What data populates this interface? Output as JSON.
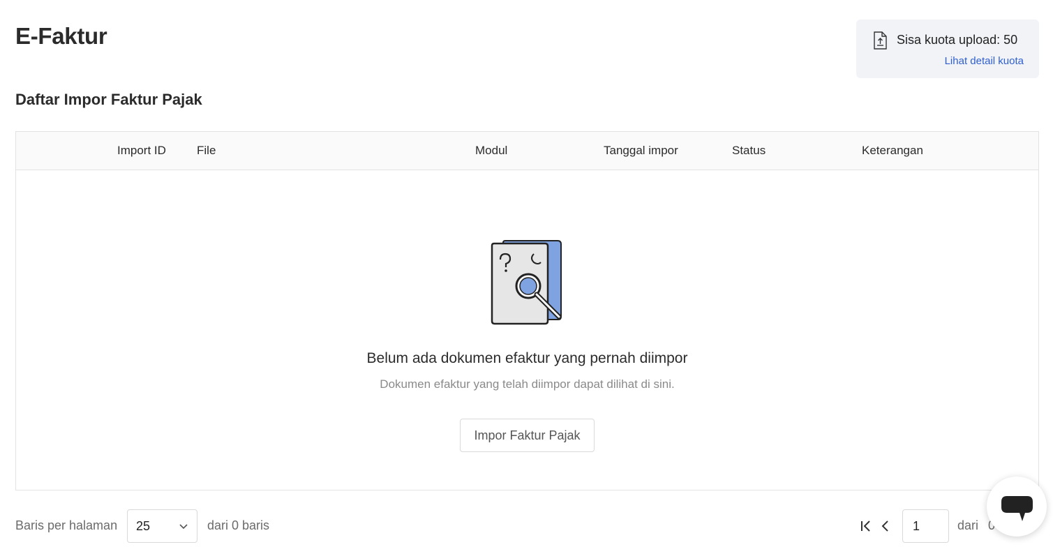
{
  "header": {
    "title": "E-Faktur"
  },
  "quota": {
    "icon": "upload-file-icon",
    "label": "Sisa kuota upload: 50",
    "link": "Lihat detail kuota"
  },
  "section": {
    "title": "Daftar Impor Faktur Pajak"
  },
  "table": {
    "columns": [
      "Import ID",
      "File",
      "Modul",
      "Tanggal impor",
      "Status",
      "Keterangan"
    ]
  },
  "empty_state": {
    "icon": "document-search-illustration",
    "title": "Belum ada dokumen efaktur yang pernah diimpor",
    "subtitle": "Dokumen efaktur yang telah diimpor dapat dilihat di sini.",
    "button": "Impor Faktur Pajak"
  },
  "pagination": {
    "rows_per_page_label": "Baris per halaman",
    "rows_per_page_value": "25",
    "total_label": "dari 0 baris",
    "current_page": "1",
    "of_label": "dari",
    "total_pages": "0"
  },
  "colors": {
    "accent_link": "#2f5fd0",
    "illustration_blue": "#7fa3e0"
  }
}
